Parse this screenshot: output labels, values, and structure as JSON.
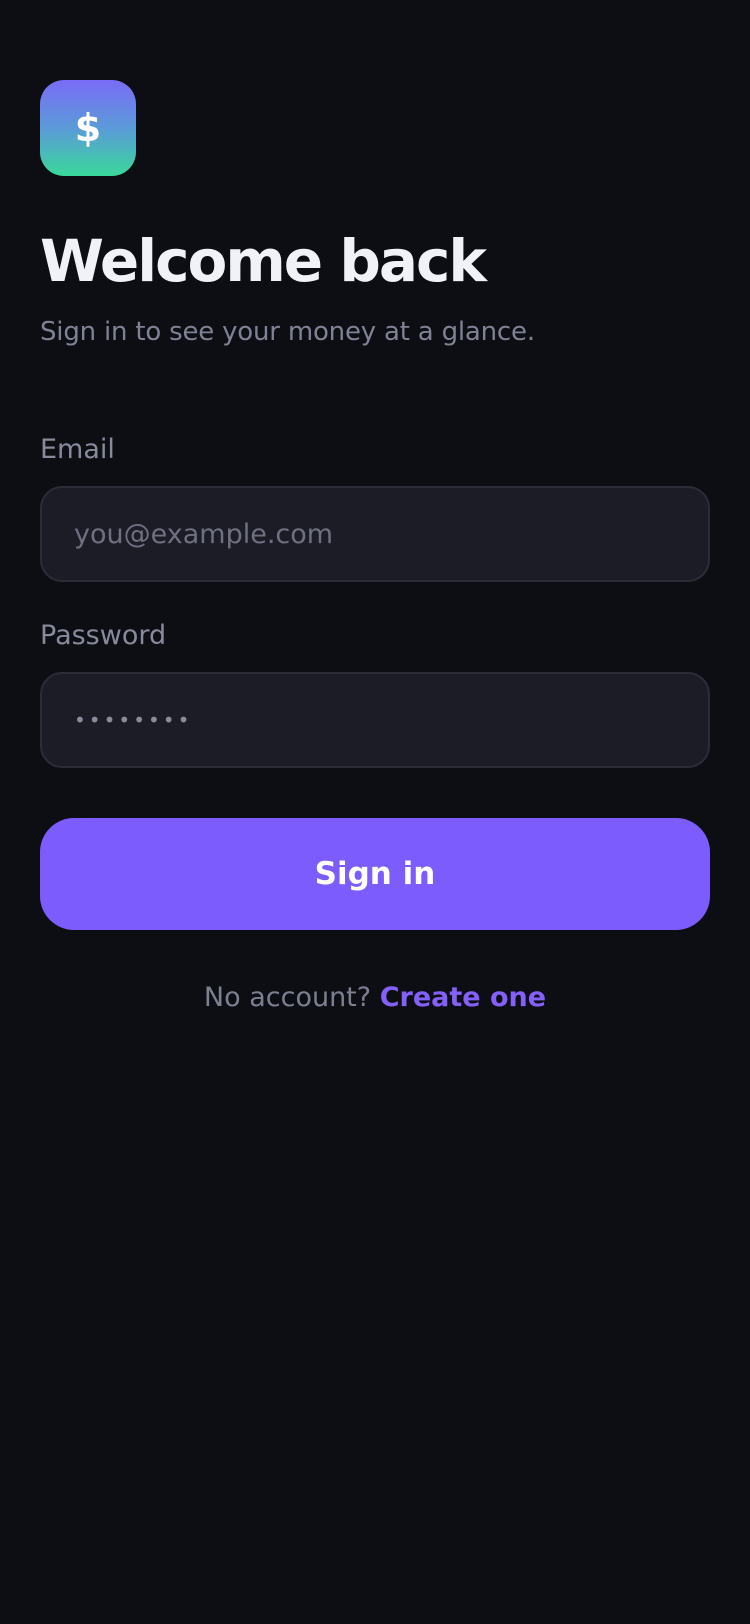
{
  "app": {
    "logo_glyph": "$",
    "logo_icon": "dollar-icon",
    "accent_color": "#7d5cfe"
  },
  "header": {
    "title": "Welcome back",
    "subtitle": "Sign in to see your money at a glance."
  },
  "form": {
    "email": {
      "label": "Email",
      "placeholder": "you@example.com",
      "value": ""
    },
    "password": {
      "label": "Password",
      "value": "••••••••"
    },
    "submit_label": "Sign in"
  },
  "footer": {
    "prompt": "No account?",
    "link_label": "Create one"
  }
}
